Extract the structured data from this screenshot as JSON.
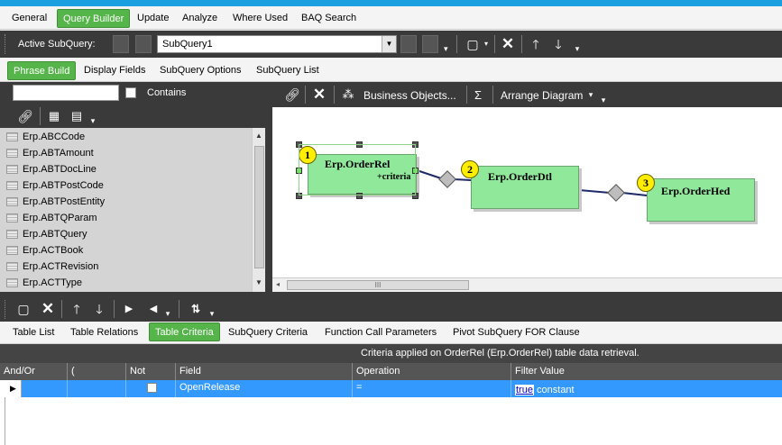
{
  "menu": {
    "tabs": [
      {
        "label": "General",
        "active": false
      },
      {
        "label": "Query Builder",
        "active": true
      },
      {
        "label": "Update",
        "active": false
      },
      {
        "label": "Analyze",
        "active": false
      },
      {
        "label": "Where Used",
        "active": false
      },
      {
        "label": "BAQ Search",
        "active": false
      }
    ]
  },
  "subquery_toolbar": {
    "label": "Active SubQuery:",
    "selected": "SubQuery1"
  },
  "sub_tabs": [
    {
      "label": "Phrase Build",
      "active": true
    },
    {
      "label": "Display Fields",
      "active": false
    },
    {
      "label": "SubQuery Options",
      "active": false
    },
    {
      "label": "SubQuery List",
      "active": false
    }
  ],
  "table_search": {
    "placeholder": "",
    "contains_label": "Contains"
  },
  "table_list": [
    "Erp.ABCCode",
    "Erp.ABTAmount",
    "Erp.ABTDocLine",
    "Erp.ABTPostCode",
    "Erp.ABTPostEntity",
    "Erp.ABTQParam",
    "Erp.ABTQuery",
    "Erp.ACTBook",
    "Erp.ACTRevision",
    "Erp.ACTType"
  ],
  "diagram_toolbar": {
    "business_objects": "Business Objects...",
    "sigma": "Σ",
    "arrange": "Arrange Diagram"
  },
  "diagram": {
    "nodes": [
      {
        "num": "1",
        "name": "Erp.OrderRel",
        "extra": "+criteria"
      },
      {
        "num": "2",
        "name": "Erp.OrderDtl",
        "extra": ""
      },
      {
        "num": "3",
        "name": "Erp.OrderHed",
        "extra": ""
      }
    ],
    "hscroll_grip": "III"
  },
  "bottom_tabs": [
    {
      "label": "Table List",
      "active": false
    },
    {
      "label": "Table Relations",
      "active": false
    },
    {
      "label": "Table Criteria",
      "active": true
    },
    {
      "label": "SubQuery Criteria",
      "active": false
    },
    {
      "label": "Function Call Parameters",
      "active": false
    },
    {
      "label": "Pivot SubQuery FOR Clause",
      "active": false
    }
  ],
  "criteria_info": "Criteria applied on OrderRel (Erp.OrderRel)  table data retrieval.",
  "grid": {
    "headers": [
      "And/Or",
      "(",
      "Not",
      "Field",
      "Operation",
      "Filter Value"
    ],
    "rows": [
      {
        "andor": "",
        "paren": "",
        "not": "",
        "field": "OpenRelease",
        "operation": "=",
        "filter_link": "true",
        "filter_rest": " constant"
      }
    ]
  },
  "colors": {
    "accent": "#56b54a",
    "selection": "#3399ff",
    "node": "#90e89a",
    "badge": "#ffee00"
  }
}
